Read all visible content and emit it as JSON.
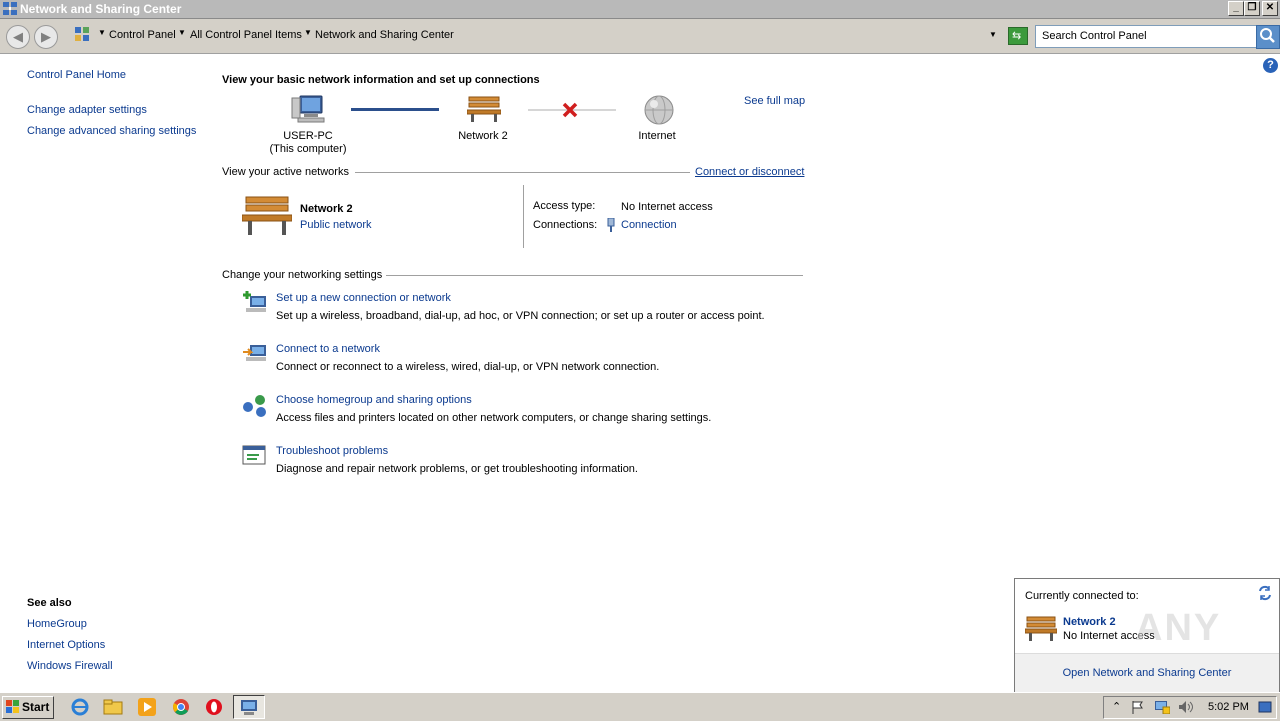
{
  "window": {
    "title": "Network and Sharing Center"
  },
  "address": {
    "crumbs": [
      "Control Panel",
      "All Control Panel Items",
      "Network and Sharing Center"
    ],
    "search_placeholder": "Search Control Panel"
  },
  "sidebar": {
    "home": "Control Panel Home",
    "links": [
      "Change adapter settings",
      "Change advanced sharing settings"
    ],
    "see_also_title": "See also",
    "see_also": [
      "HomeGroup",
      "Internet Options",
      "Windows Firewall"
    ]
  },
  "main": {
    "heading": "View your basic network information and set up connections",
    "see_full_map": "See full map",
    "map": {
      "computer_name": "USER-PC",
      "computer_sub": "(This computer)",
      "network": "Network  2",
      "internet": "Internet"
    },
    "active_header": "View your active networks",
    "connect_link": "Connect or disconnect",
    "active_network": {
      "name": "Network  2",
      "type": "Public network",
      "access_label": "Access type:",
      "access_value": "No Internet access",
      "connections_label": "Connections:",
      "connections_value": "Connection"
    },
    "settings_header": "Change your networking settings",
    "tasks": [
      {
        "title": "Set up a new connection or network",
        "desc": "Set up a wireless, broadband, dial-up, ad hoc, or VPN connection; or set up a router or access point."
      },
      {
        "title": "Connect to a network",
        "desc": "Connect or reconnect to a wireless, wired, dial-up, or VPN network connection."
      },
      {
        "title": "Choose homegroup and sharing options",
        "desc": "Access files and printers located on other network computers, or change sharing settings."
      },
      {
        "title": "Troubleshoot problems",
        "desc": "Diagnose and repair network problems, or get troubleshooting information."
      }
    ]
  },
  "popup": {
    "header": "Currently connected to:",
    "network": "Network  2",
    "status": "No Internet access",
    "footer_link": "Open Network and Sharing Center",
    "watermark": "ANY RUN"
  },
  "taskbar": {
    "start": "Start",
    "clock": "5:02 PM"
  },
  "colors": {
    "link": "#0b3a8f",
    "accent": "#d4d0c8",
    "error_x": "#d01e1e"
  }
}
